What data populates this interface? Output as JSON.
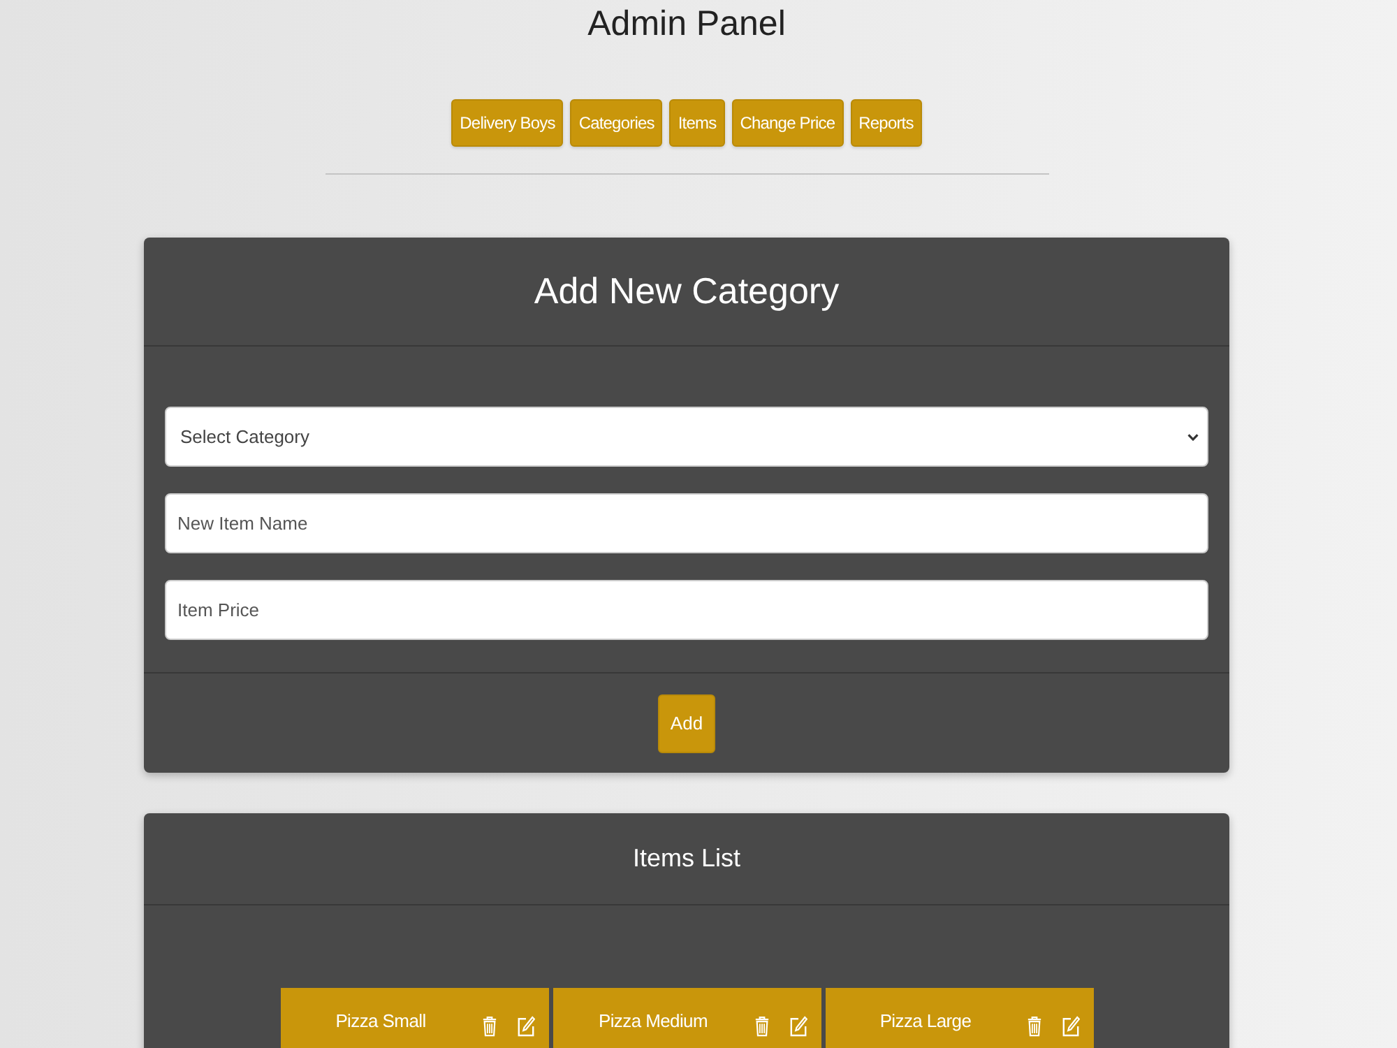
{
  "page": {
    "title": "Admin Panel"
  },
  "nav": [
    {
      "label": "Delivery Boys"
    },
    {
      "label": "Categories"
    },
    {
      "label": "Items"
    },
    {
      "label": "Change Price"
    },
    {
      "label": "Reports"
    }
  ],
  "add_category": {
    "title": "Add New Category",
    "select": {
      "value": "Select Category"
    },
    "fields": [
      {
        "placeholder": "New Item Name"
      },
      {
        "placeholder": "Item Price"
      }
    ],
    "button": "Add"
  },
  "items_list": {
    "title": "Items List",
    "items": [
      {
        "name": "Pizza Small"
      },
      {
        "name": "Pizza Medium"
      },
      {
        "name": "Pizza Large"
      }
    ]
  }
}
